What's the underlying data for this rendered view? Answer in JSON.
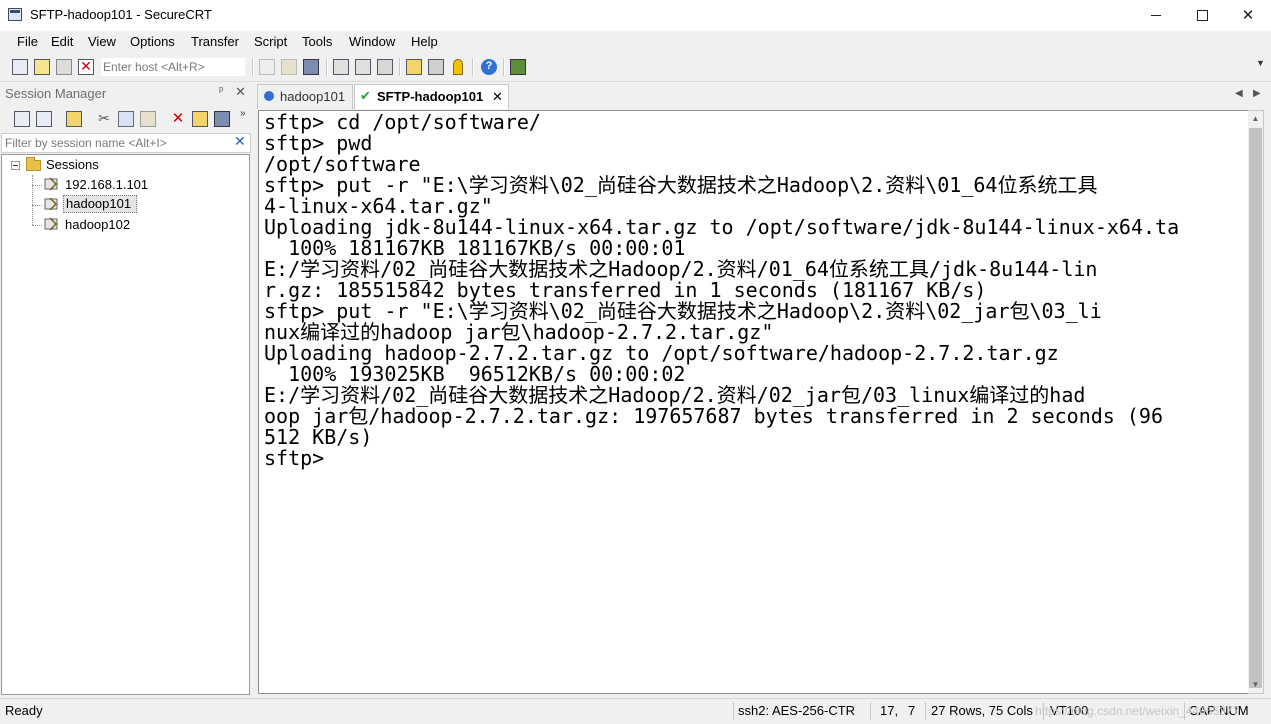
{
  "window": {
    "title": "SFTP-hadoop101 - SecureCRT"
  },
  "menu": [
    "File",
    "Edit",
    "View",
    "Options",
    "Transfer",
    "Script",
    "Tools",
    "Window",
    "Help"
  ],
  "toolbar": {
    "host_placeholder": "Enter host <Alt+R>"
  },
  "session_manager": {
    "title": "Session Manager",
    "filter_placeholder": "Filter by session name <Alt+I>",
    "root": "Sessions",
    "sessions": [
      "192.168.1.101",
      "hadoop101",
      "hadoop102"
    ],
    "selected": "hadoop101"
  },
  "tabs": [
    {
      "label": "hadoop101",
      "active": false
    },
    {
      "label": "SFTP-hadoop101",
      "active": true
    }
  ],
  "terminal": {
    "lines": [
      "sftp> cd /opt/software/",
      "sftp> pwd",
      "/opt/software",
      "sftp> put -r \"E:\\学习资料\\02_尚硅谷大数据技术之Hadoop\\2.资料\\01_64位系统工具",
      "4-linux-x64.tar.gz\"",
      "Uploading jdk-8u144-linux-x64.tar.gz to /opt/software/jdk-8u144-linux-x64.ta",
      "  100% 181167KB 181167KB/s 00:00:01",
      "E:/学习资料/02_尚硅谷大数据技术之Hadoop/2.资料/01_64位系统工具/jdk-8u144-lin",
      "r.gz: 185515842 bytes transferred in 1 seconds (181167 KB/s)",
      "sftp> put -r \"E:\\学习资料\\02_尚硅谷大数据技术之Hadoop\\2.资料\\02_jar包\\03_li",
      "nux编译过的hadoop jar包\\hadoop-2.7.2.tar.gz\"",
      "Uploading hadoop-2.7.2.tar.gz to /opt/software/hadoop-2.7.2.tar.gz",
      "  100% 193025KB  96512KB/s 00:00:02",
      "E:/学习资料/02_尚硅谷大数据技术之Hadoop/2.资料/02_jar包/03_linux编译过的had",
      "oop jar包/hadoop-2.7.2.tar.gz: 197657687 bytes transferred in 2 seconds (96",
      "512 KB/s)",
      "sftp>"
    ]
  },
  "status": {
    "ready": "Ready",
    "cipher": "ssh2: AES-256-CTR",
    "cursor_row": "17,",
    "cursor_col": "7",
    "dimensions": "27 Rows, 75 Cols",
    "terminal_type": "VT100",
    "caps": "CAP",
    "num": "NUM"
  },
  "watermark": "https://blog.csdn.net/weixin_44065377"
}
